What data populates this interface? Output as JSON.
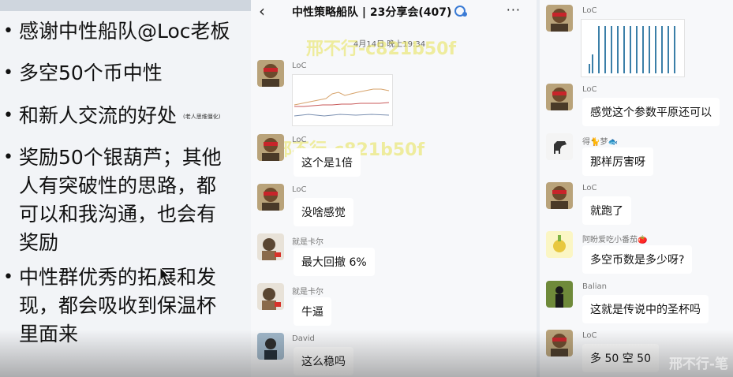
{
  "slide": {
    "bullets": [
      {
        "text": "感谢中性船队@Loc老板",
        "small": ""
      },
      {
        "text": "多空50个币中性",
        "small": ""
      },
      {
        "text": "和新人交流的好处",
        "small": "(老人思维僵化)"
      },
      {
        "text": "奖励50个银葫芦；其他人有突破性的思路，都可以和我沟通，也会有奖励",
        "small": ""
      },
      {
        "text": "中性群优秀的拓展和发现，都会吸收到保温杯里面来",
        "small": ""
      }
    ],
    "bullet_symbol": "•"
  },
  "chat_left": {
    "back_icon": "‹",
    "title": "中性策略船队 | 23分享会(407)",
    "more_icon": "···",
    "timestamp": "4月14日 晚上19:34",
    "watermark": "邢不行-c821b50f",
    "messages": [
      {
        "sender": "LoC",
        "text": ""
      },
      {
        "sender": "LoC",
        "text": "这个是1倍"
      },
      {
        "sender": "LoC",
        "text": "没啥感觉"
      },
      {
        "sender": "就是卡尔",
        "text": "最大回撤 6%"
      },
      {
        "sender": "就是卡尔",
        "text": "牛逼"
      },
      {
        "sender": "David",
        "text": "这么稳吗"
      }
    ]
  },
  "chat_right": {
    "messages": [
      {
        "sender": "LoC",
        "text": ""
      },
      {
        "sender": "LoC",
        "text": "感觉这个参数平原还可以"
      },
      {
        "sender": "得🐈梦🐟",
        "text": "那样厉害呀"
      },
      {
        "sender": "LoC",
        "text": "就跑了"
      },
      {
        "sender": "阿盼爱吃小番茄🍅",
        "text": "多空币数是多少呀?"
      },
      {
        "sender": "Balian",
        "text": "这就是传说中的圣杯吗"
      },
      {
        "sender": "LoC",
        "text": "多 50 空 50"
      }
    ]
  },
  "corner_watermark": "邢不行-笔"
}
